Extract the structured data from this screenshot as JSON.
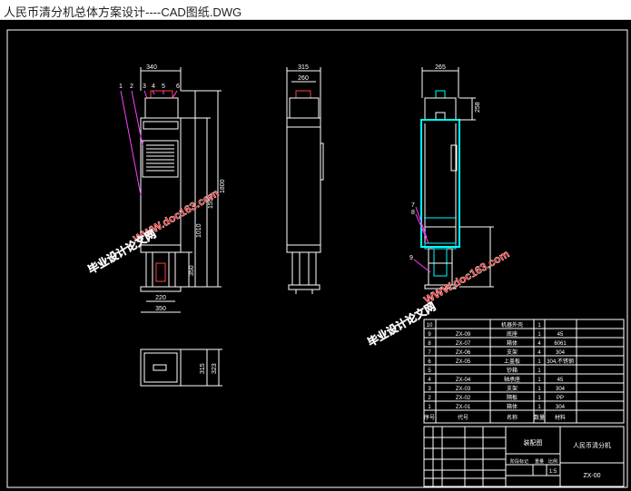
{
  "window": {
    "title": "人民币清分机总体方案设计----CAD图纸.DWG"
  },
  "colors": {
    "background": "#000000",
    "line_white": "#ffffff",
    "line_cyan": "#00ffff",
    "line_red": "#ff3030",
    "line_magenta": "#ff40ff",
    "watermark": "#ff2020"
  },
  "front_view": {
    "dim_top": "340",
    "dim_inner_220": "220",
    "dim_base_350": "350",
    "dim_height_1800": "1800",
    "dim_height_1550": "1550",
    "dim_height_1010": "1010",
    "dim_height_350": "350",
    "balloons": [
      "1",
      "2",
      "3",
      "4",
      "5",
      "6"
    ]
  },
  "side_view": {
    "dim_top_315": "315",
    "dim_inner_260": "260"
  },
  "section_view": {
    "dim_top_265": "265",
    "dim_right_258": "258",
    "balloons": [
      "7",
      "8",
      "9"
    ]
  },
  "top_view": {
    "dim_315": "315",
    "dim_323": "323"
  },
  "watermarks": {
    "url": "WWW.doc163.com",
    "cn": "毕业设计论文网"
  },
  "bom": {
    "rows": [
      {
        "no": "10",
        "code": "",
        "name": "机器外壳",
        "qty": "1",
        "mat": ""
      },
      {
        "no": "9",
        "code": "ZX-09",
        "name": "底座",
        "qty": "1",
        "mat": "45"
      },
      {
        "no": "8",
        "code": "ZX-07",
        "name": "箱体",
        "qty": "4",
        "mat": "6061"
      },
      {
        "no": "7",
        "code": "ZX-06",
        "name": "支架",
        "qty": "4",
        "mat": "304"
      },
      {
        "no": "6",
        "code": "ZX-05",
        "name": "上盖板",
        "qty": "1",
        "mat": "304,不锈钢"
      },
      {
        "no": "5",
        "code": "",
        "name": "钞箱",
        "qty": "1",
        "mat": ""
      },
      {
        "no": "4",
        "code": "ZX-04",
        "name": "轴承座",
        "qty": "1",
        "mat": "45"
      },
      {
        "no": "3",
        "code": "ZX-03",
        "name": "支架",
        "qty": "1",
        "mat": "304"
      },
      {
        "no": "2",
        "code": "ZX-02",
        "name": "隔板",
        "qty": "1",
        "mat": "PP"
      },
      {
        "no": "1",
        "code": "ZX-01",
        "name": "箱体",
        "qty": "1",
        "mat": "304"
      }
    ],
    "header": {
      "no": "序号",
      "code": "代号",
      "name": "名称",
      "qty": "数量",
      "mat": "材料"
    }
  },
  "title_block": {
    "assembly_name": "装配图",
    "drawing_title": "人民币清分机",
    "drawing_code": "ZX-00",
    "scale": "1:5",
    "stage": "阶段标记",
    "weight": "重量",
    "ratio": "比例"
  }
}
